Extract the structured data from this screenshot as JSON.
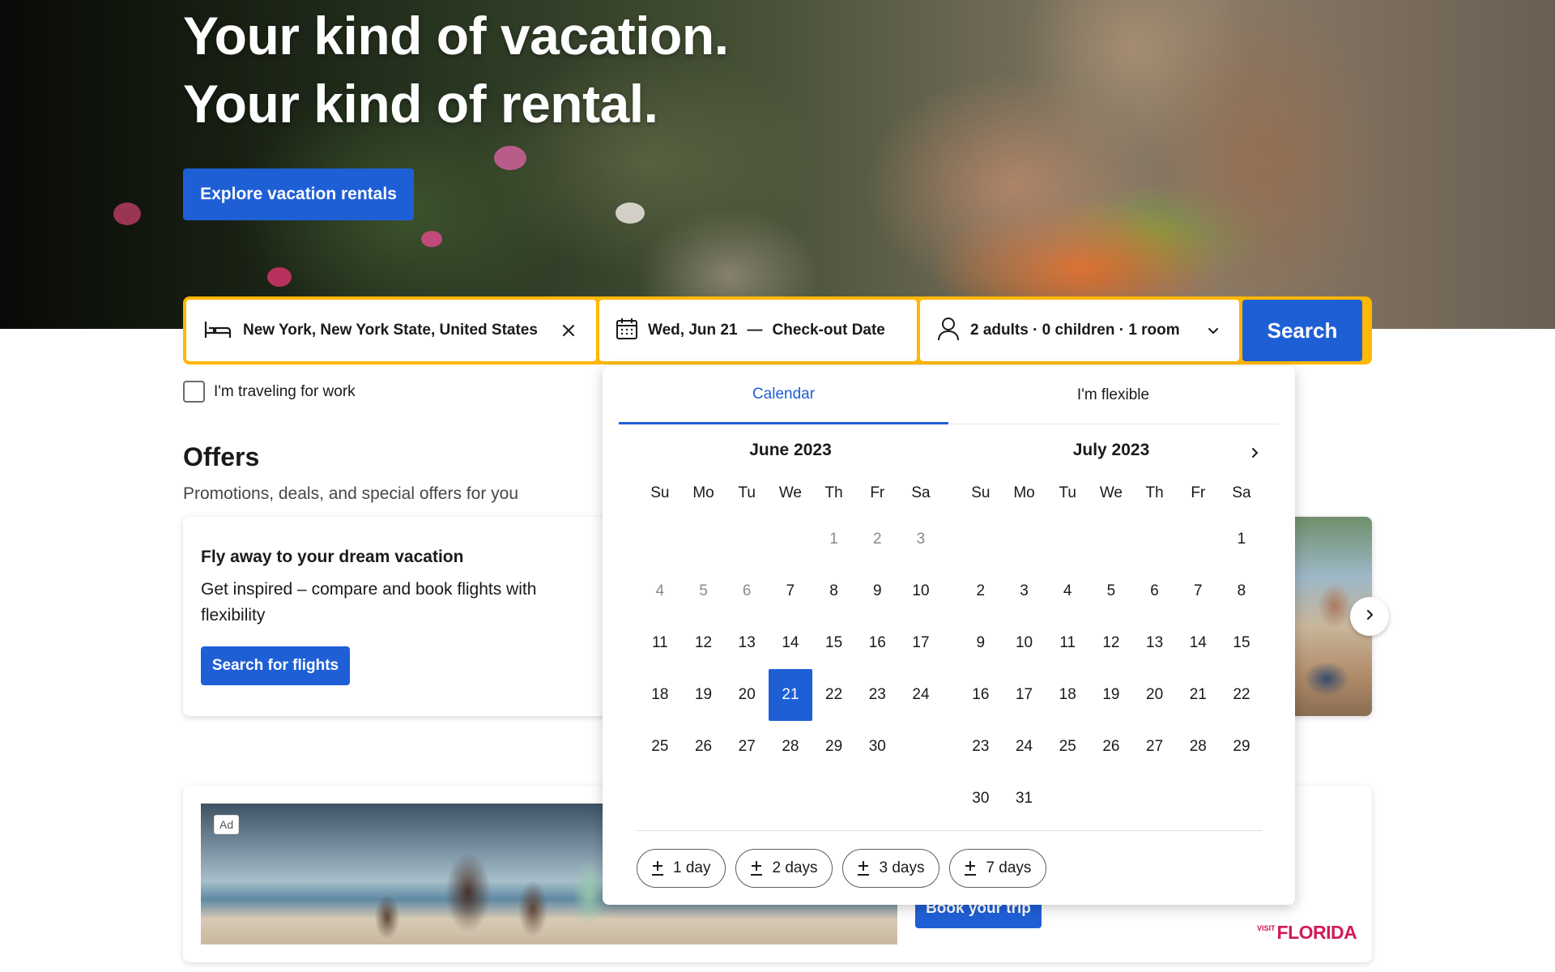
{
  "hero": {
    "title_line1": "Your kind of vacation.",
    "title_line2": "Your kind of rental.",
    "explore_button": "Explore vacation rentals"
  },
  "search": {
    "destination": "New York, New York State, United States",
    "checkin": "Wed, Jun 21",
    "dash": "—",
    "checkout_placeholder": "Check-out Date",
    "guests": "2 adults · 0 children · 1 room",
    "search_button": "Search",
    "icons": {
      "destination": "bed-icon",
      "dates": "calendar-icon",
      "guests": "person-icon",
      "clear": "close-icon",
      "dropdown": "chevron-down-icon"
    }
  },
  "work_travel": {
    "label": "I'm traveling for work",
    "checked": false
  },
  "offers": {
    "title": "Offers",
    "subtitle": "Promotions, deals, and special offers for you",
    "card_title": "Fly away to your dream vacation",
    "card_text": "Get inspired – compare and book flights with flexibility",
    "card_button": "Search for flights"
  },
  "ad": {
    "badge": "Ad",
    "button": "Book your trip",
    "logo_visit": "VISIT",
    "logo_name": "FLORIDA"
  },
  "calendar": {
    "tabs": [
      "Calendar",
      "I'm flexible"
    ],
    "active_tab": 0,
    "weekdays": [
      "Su",
      "Mo",
      "Tu",
      "We",
      "Th",
      "Fr",
      "Sa"
    ],
    "months": [
      {
        "title": "June 2023",
        "first_weekday": 4,
        "days": 30,
        "past_until": 6,
        "selected": 21
      },
      {
        "title": "July 2023",
        "first_weekday": 6,
        "days": 31,
        "past_until": 0,
        "selected": null
      }
    ],
    "flex_options": [
      "1 day",
      "2 days",
      "3 days",
      "7 days"
    ]
  },
  "colors": {
    "accent": "#1f5fd6",
    "search_border": "#ffb700",
    "brand_florida": "#d11a5b"
  }
}
